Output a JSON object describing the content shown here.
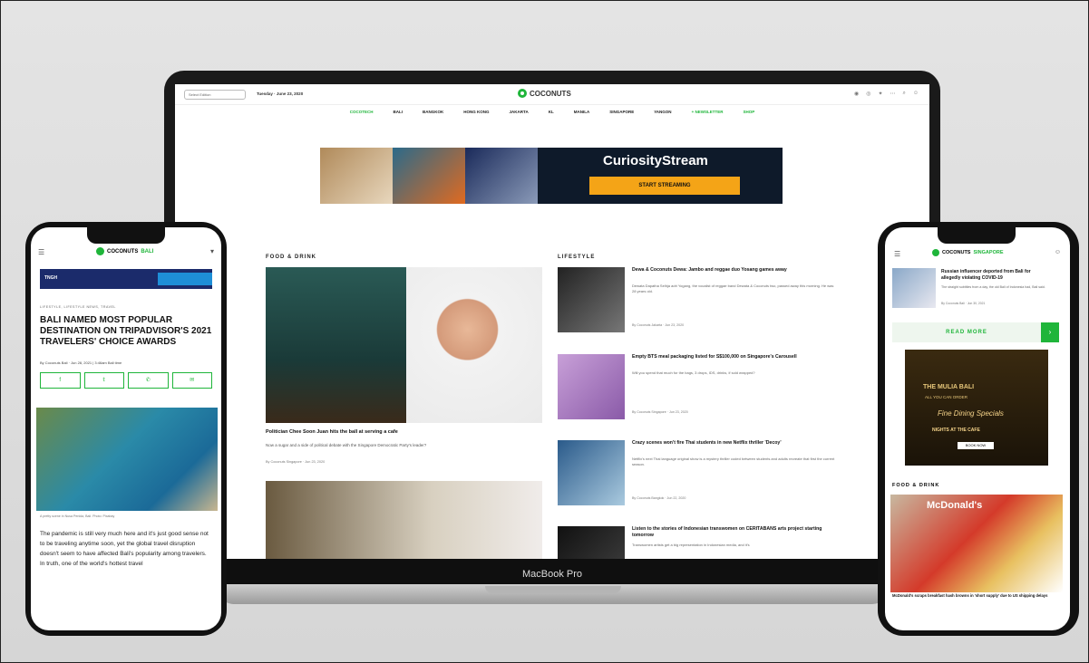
{
  "laptop": {
    "label": "MacBook Pro",
    "edition": "Select Edition",
    "date": "Tuesday · June 23, 2020",
    "brand": "COCONUTS",
    "nav": [
      "COCOTECH",
      "BALI",
      "BANGKOK",
      "HONG KONG",
      "JAKARTA",
      "KL",
      "MANILA",
      "SINGAPORE",
      "YANGON",
      "+ NEWSLETTER",
      "SHOP"
    ],
    "ad": {
      "brand": "CuriosityStream",
      "cta": "START STREAMING"
    },
    "food_drink": {
      "section": "FOOD & DRINK",
      "headline": "Politician Chee Soon Juan hits the ball at serving a cafe",
      "sub": "Now a sugar and a side of political debate with the Singapore Democratic Party's leader?",
      "byline": "By Coconuts Singapore · Jun 23, 2020"
    },
    "lifestyle": {
      "section": "LIFESTYLE",
      "items": [
        {
          "title": "Dewa & Coconuts Dewa: Jambo and reggae duo Yosang games away",
          "desc": "Dewata Dapatha Selhja adri Yogang, the vocalist of reggae band Dewata & Coconuts two, passed away this morning. He was 28 years old.",
          "byline": "By Coconuts Jakarta · Jun 23, 2020"
        },
        {
          "title": "Empty BTS meal packaging listed for S$100,000 on Singapore's Carousell",
          "desc": "Will you spend that much for the bags, 3 drops, IDS, drinks, if sold wrapped?",
          "byline": "By Coconuts Singapore · Jun 23, 2020"
        },
        {
          "title": "Crazy scenes won't fire Thai students in new Netflix thriller 'Decoy'",
          "desc": "Netflix's next Thai language original show is a mystery thriller coded between students and adults recreate that first the current season.",
          "byline": "By Coconuts Bangkok · Jun 22, 2020"
        },
        {
          "title": "Listen to the stories of Indonesian transwomen on CERITABANS arts project starting tomorrow",
          "desc": "Transwomen artists get a big representation in Indonesian media, and it's",
          "byline": ""
        }
      ]
    }
  },
  "phone_left": {
    "brand": "COCONUTS",
    "edition": "BALI",
    "ad_label": "TNGH",
    "categories": "LIFESTYLE, LIFESTYLE NEWS, TRAVEL",
    "headline": "BALI NAMED MOST POPULAR DESTINATION ON TRIPADVISOR'S 2021 TRAVELERS' CHOICE AWARDS",
    "byline": "By Coconuts Bali · Jun 28, 2021 | 3:46am Bali time",
    "share": [
      "f",
      "𝕥",
      "✆",
      "✉"
    ],
    "caption": "A pretty scene in Nusa Penida, Bali. Photo: Pixabay",
    "body": "The pandemic is still very much here and it's just good sense not to be traveling anytime soon, yet the global travel disruption doesn't seem to have affected Bali's popularity among travelers. In truth, one of the world's hottest travel"
  },
  "phone_right": {
    "brand": "COCONUTS",
    "edition": "SINGAPORE",
    "top_story": {
      "title": "Russian influencer deported from Bali for allegedly violating COVID-19",
      "desc": "The straight subtitles from a day, the old Bali of Indonesia had, Bali said.",
      "byline": "By Coconuts Bali · Jun 30, 2021"
    },
    "read_more": "READ MORE",
    "ad": {
      "l1": "THE MULIA BALI",
      "l2": "ALL YOU CAN ORDER",
      "l3": "Fine Dining Specials",
      "l4": "NIGHTS AT THE CAFE",
      "btn": "BOOK NOW"
    },
    "section": "FOOD & DRINK",
    "story_caption": "McDonald's scraps breakfast hash browns in 'short supply' due to US shipping delays"
  },
  "colors": {
    "accent": "#1fb53a",
    "device": "#111111",
    "background": "#dcdcdc"
  }
}
